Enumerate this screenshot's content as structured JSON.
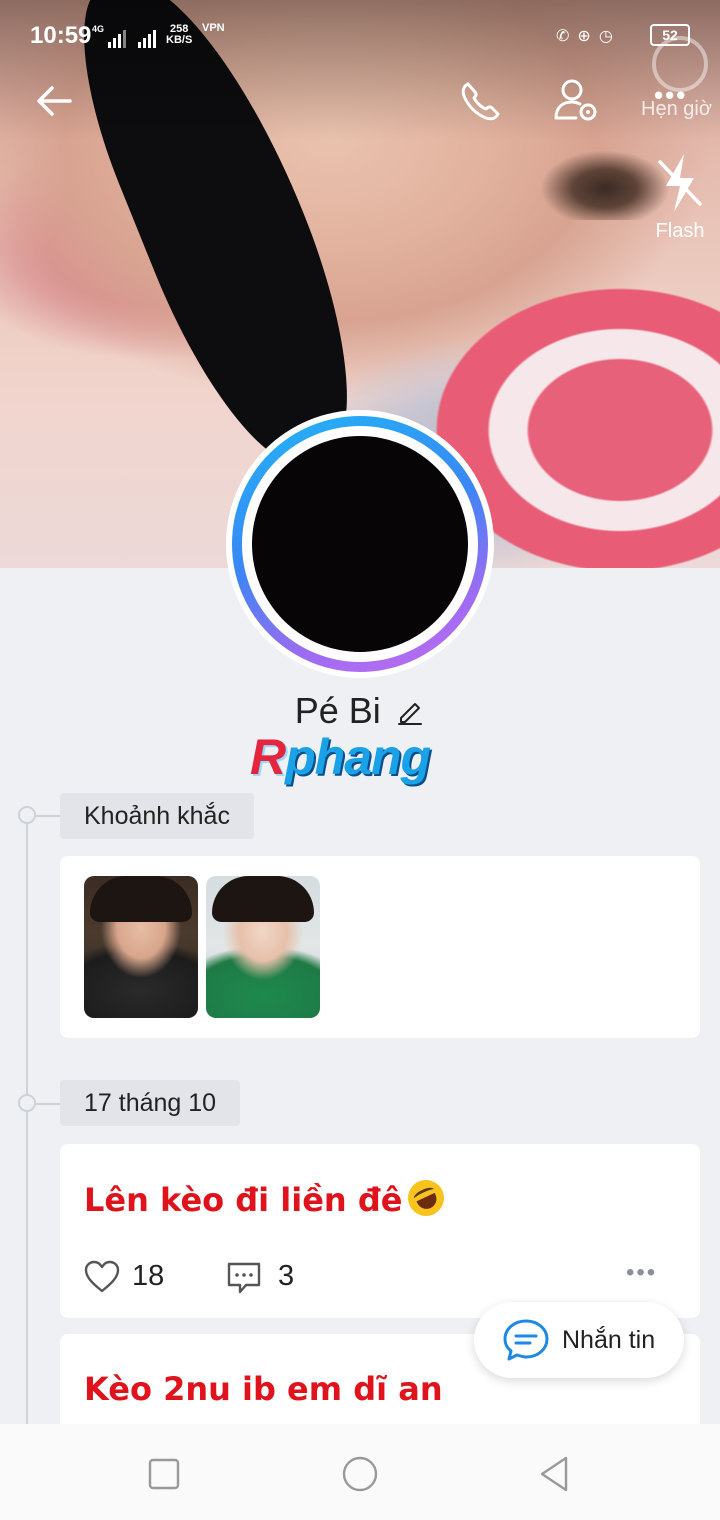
{
  "status_bar": {
    "time": "10:59",
    "network": "4G",
    "speed_value": "258",
    "speed_unit": "KB/S",
    "vpn": "VPN",
    "battery": "52"
  },
  "header": {
    "timer_label": "Hẹn giờ",
    "flash_label": "Flash"
  },
  "profile": {
    "name": "Pé Bi",
    "watermark_first": "R",
    "watermark_rest": "phang"
  },
  "moments": {
    "label": "Khoảnh khắc"
  },
  "date_section": {
    "label": "17 tháng 10"
  },
  "posts": [
    {
      "text": "Lên kèo đi liền đê",
      "likes": "18",
      "comments": "3"
    },
    {
      "text": "Kèo 2nu ib em dĩ an"
    }
  ],
  "message_button": {
    "label": "Nhắn tin"
  },
  "colors": {
    "accent": "#1e88e5",
    "post_text": "#e0121b",
    "ring_start": "#20b6f7",
    "ring_end": "#c56cf0"
  }
}
